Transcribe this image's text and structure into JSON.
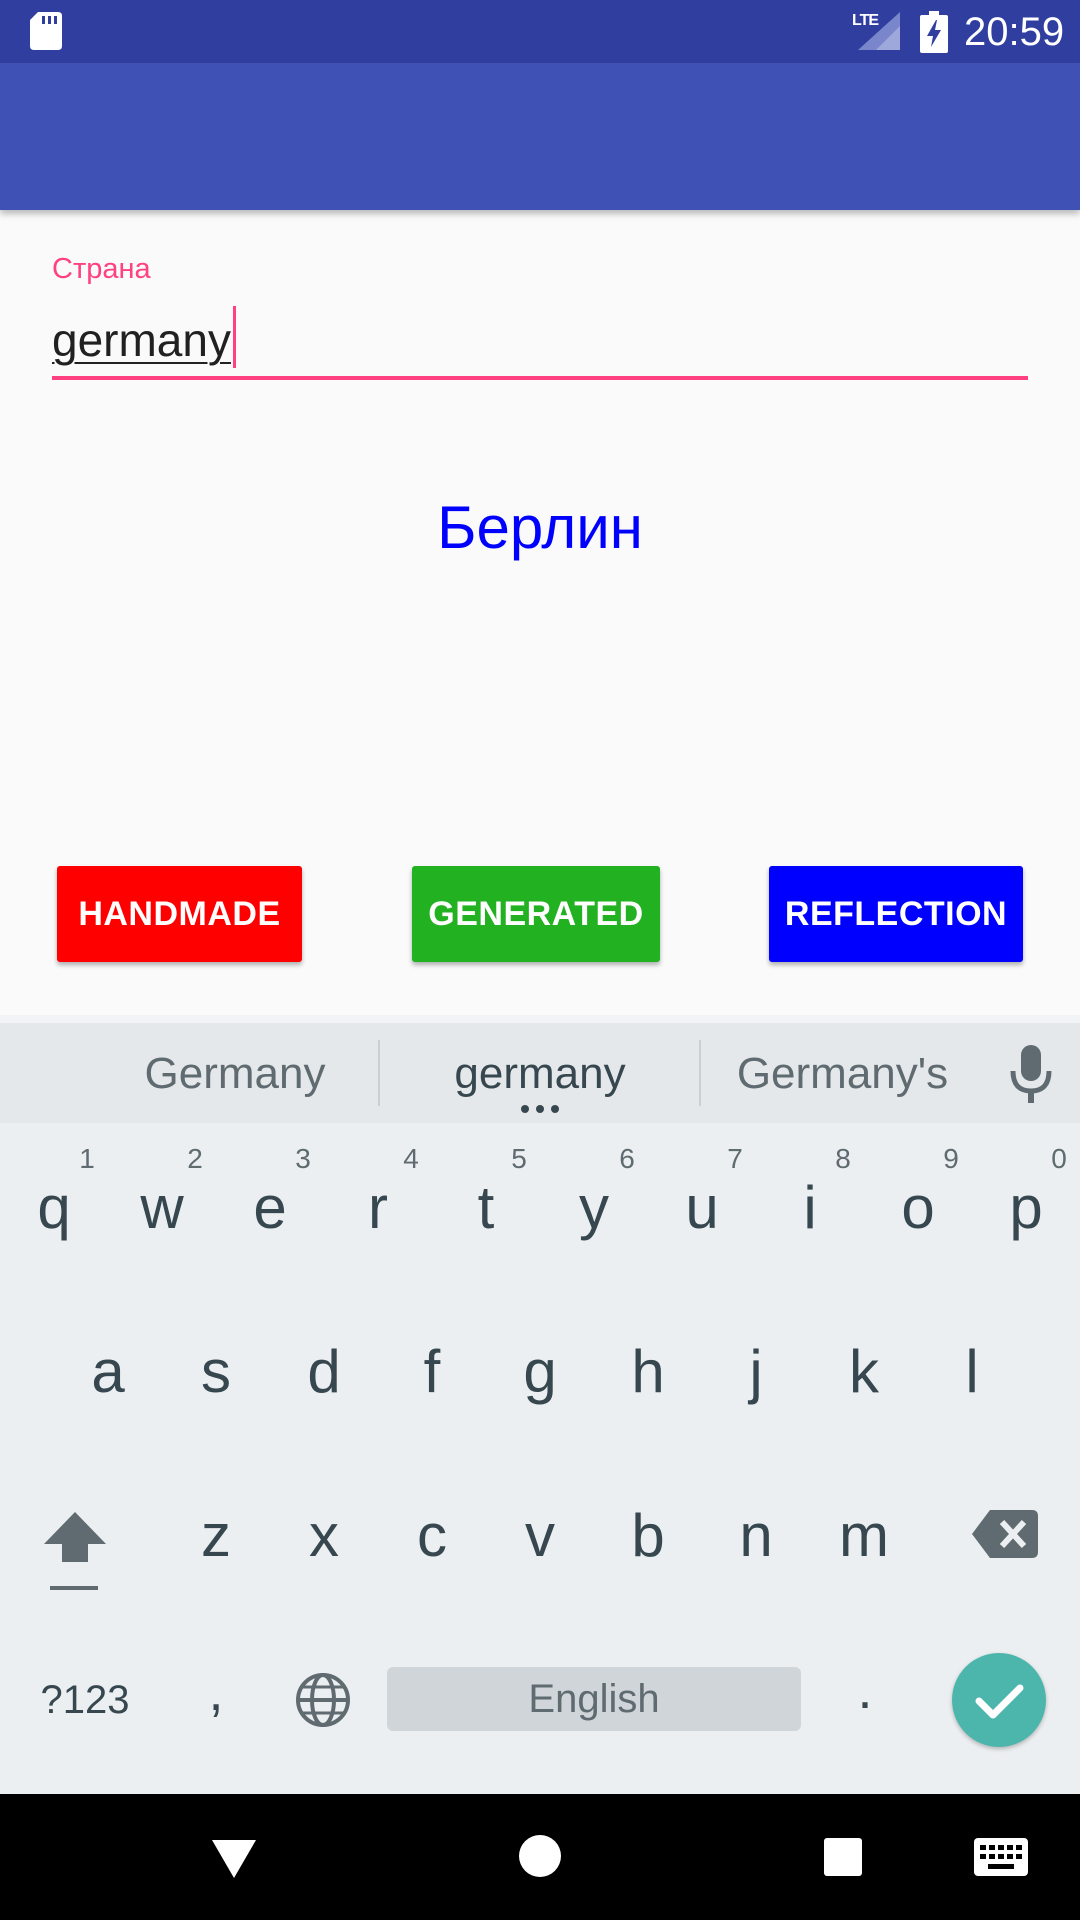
{
  "status_bar": {
    "network_label": "LTE",
    "time": "20:59",
    "icons": [
      "sd-card-icon",
      "signal-icon",
      "battery-charging-icon"
    ]
  },
  "form": {
    "field_label": "Страна",
    "field_value": "germany"
  },
  "result": {
    "text": "Берлин"
  },
  "buttons": {
    "handmade": "HANDMADE",
    "generated": "GENERATED",
    "reflection": "REFLECTION"
  },
  "colors": {
    "status_bar": "#303f9f",
    "app_bar": "#3f51b5",
    "accent": "#ff4081",
    "result_text": "#0000ff",
    "handmade": "#ff0000",
    "generated": "#21b121",
    "reflection": "#0000ff",
    "enter_key": "#4db6ac"
  },
  "keyboard": {
    "suggestions": [
      "Germany",
      "germany",
      "Germany's"
    ],
    "row1": [
      "q",
      "w",
      "e",
      "r",
      "t",
      "y",
      "u",
      "i",
      "o",
      "p"
    ],
    "row1_hints": [
      "1",
      "2",
      "3",
      "4",
      "5",
      "6",
      "7",
      "8",
      "9",
      "0"
    ],
    "row2": [
      "a",
      "s",
      "d",
      "f",
      "g",
      "h",
      "j",
      "k",
      "l"
    ],
    "row3": [
      "z",
      "x",
      "c",
      "v",
      "b",
      "n",
      "m"
    ],
    "symbols_key": "?123",
    "comma": ",",
    "space_label": "English",
    "period": "."
  },
  "nav_bar": {
    "icons": [
      "back-icon",
      "home-icon",
      "recents-icon",
      "keyboard-switch-icon"
    ]
  }
}
